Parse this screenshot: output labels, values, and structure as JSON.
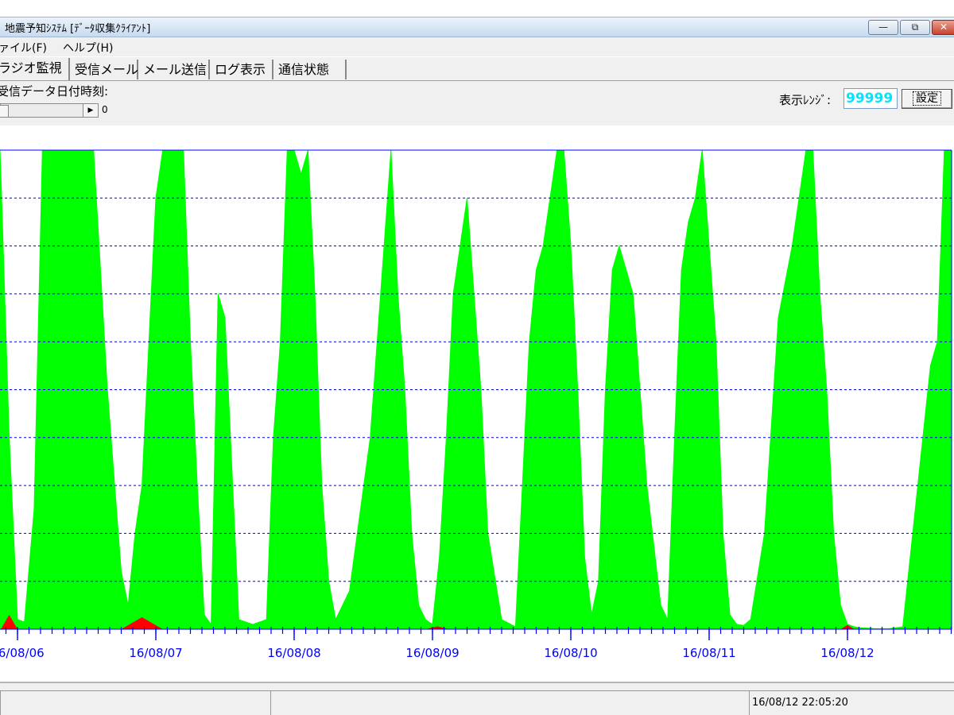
{
  "window": {
    "title": "地震予知ｼｽﾃﾑ [ﾃﾞｰﾀ収集ｸﾗｲｱﾝﾄ]",
    "minimize": "—",
    "maximize": "⧉",
    "close": "✕"
  },
  "menu": {
    "file": "ァイル(F)",
    "help": "ヘルプ(H)"
  },
  "tabs": [
    {
      "label": "ラジオ監視"
    },
    {
      "label": "受信メール"
    },
    {
      "label": "メール送信"
    },
    {
      "label": "ログ表示"
    },
    {
      "label": "通信状態"
    }
  ],
  "toolbar": {
    "received_label": "受信データ日付時刻:",
    "scroll_value": "0",
    "range_label": "表示ﾚﾝｼﾞ:",
    "range_value": "99999",
    "set_button": "設定"
  },
  "chart_data": {
    "type": "area",
    "x_tick_labels": [
      "16/08/06",
      "16/08/07",
      "16/08/08",
      "16/08/09",
      "16/08/10",
      "16/08/11",
      "16/08/12"
    ],
    "ylim": [
      0,
      99999
    ],
    "grid": true,
    "colors": {
      "signal": "#00ff00",
      "alert": "#ff0000",
      "grid": "#0000cc",
      "axis": "#0000ff"
    },
    "series": [
      {
        "x": [
          -0.22,
          -0.18,
          -0.12,
          -0.06,
          0.0,
          0.05,
          0.12,
          0.18,
          0.22,
          0.3,
          0.45,
          0.55,
          0.65,
          0.75,
          0.8,
          0.85,
          0.9,
          0.95,
          1.0,
          1.05,
          1.1,
          1.15,
          1.2,
          1.25,
          1.3,
          1.35,
          1.4,
          1.45,
          1.5,
          1.6,
          1.7,
          1.8,
          1.85,
          1.9,
          1.95,
          2.0,
          2.05,
          2.1,
          2.15,
          2.2,
          2.25,
          2.3,
          2.4,
          2.55,
          2.6,
          2.65,
          2.7,
          2.75,
          2.8,
          2.85,
          2.9,
          2.95,
          3.0,
          3.05,
          3.1,
          3.15,
          3.2,
          3.25,
          3.3,
          3.35,
          3.4,
          3.5,
          3.6,
          3.65,
          3.7,
          3.75,
          3.8,
          3.85,
          3.9,
          3.95,
          4.0,
          4.05,
          4.1,
          4.15,
          4.2,
          4.25,
          4.3,
          4.35,
          4.45,
          4.55,
          4.65,
          4.7,
          4.75,
          4.8,
          4.85,
          4.9,
          4.95,
          5.0,
          5.05,
          5.1,
          5.15,
          5.2,
          5.25,
          5.3,
          5.4,
          5.5,
          5.6,
          5.65,
          5.7,
          5.75,
          5.8,
          5.85,
          5.9,
          5.95,
          6.0,
          6.05,
          6.1,
          6.15,
          6.2,
          6.25,
          6.3,
          6.4,
          6.6,
          6.65,
          6.7,
          6.75,
          6.8,
          6.85
        ],
        "y": [
          100000,
          100000,
          95000,
          40000,
          2000,
          1500,
          25000,
          100000,
          100000,
          100000,
          100000,
          100000,
          50000,
          12000,
          5000,
          20000,
          30000,
          60000,
          90000,
          100000,
          100000,
          100000,
          100000,
          60000,
          30000,
          3000,
          1000,
          70000,
          65000,
          2000,
          1000,
          2000,
          40000,
          60000,
          100000,
          100000,
          95000,
          100000,
          70000,
          30000,
          10000,
          2000,
          8000,
          40000,
          60000,
          80000,
          100000,
          70000,
          50000,
          20000,
          5000,
          2000,
          1000,
          15000,
          40000,
          70000,
          80000,
          90000,
          70000,
          50000,
          20000,
          2000,
          500,
          30000,
          60000,
          75000,
          80000,
          90000,
          100000,
          100000,
          80000,
          50000,
          15000,
          3000,
          10000,
          50000,
          75000,
          80000,
          70000,
          30000,
          5000,
          2000,
          40000,
          75000,
          85000,
          90000,
          100000,
          80000,
          60000,
          20000,
          3000,
          1000,
          800,
          2000,
          20000,
          65000,
          80000,
          90000,
          100000,
          100000,
          70000,
          50000,
          20000,
          5000,
          1000,
          500,
          300,
          200,
          100,
          100,
          100,
          500,
          55000,
          60000,
          100000,
          100000,
          80000,
          10000
        ]
      }
    ]
  },
  "status": {
    "pane1": "",
    "pane2": "",
    "datetime": "16/08/12 22:05:20"
  }
}
